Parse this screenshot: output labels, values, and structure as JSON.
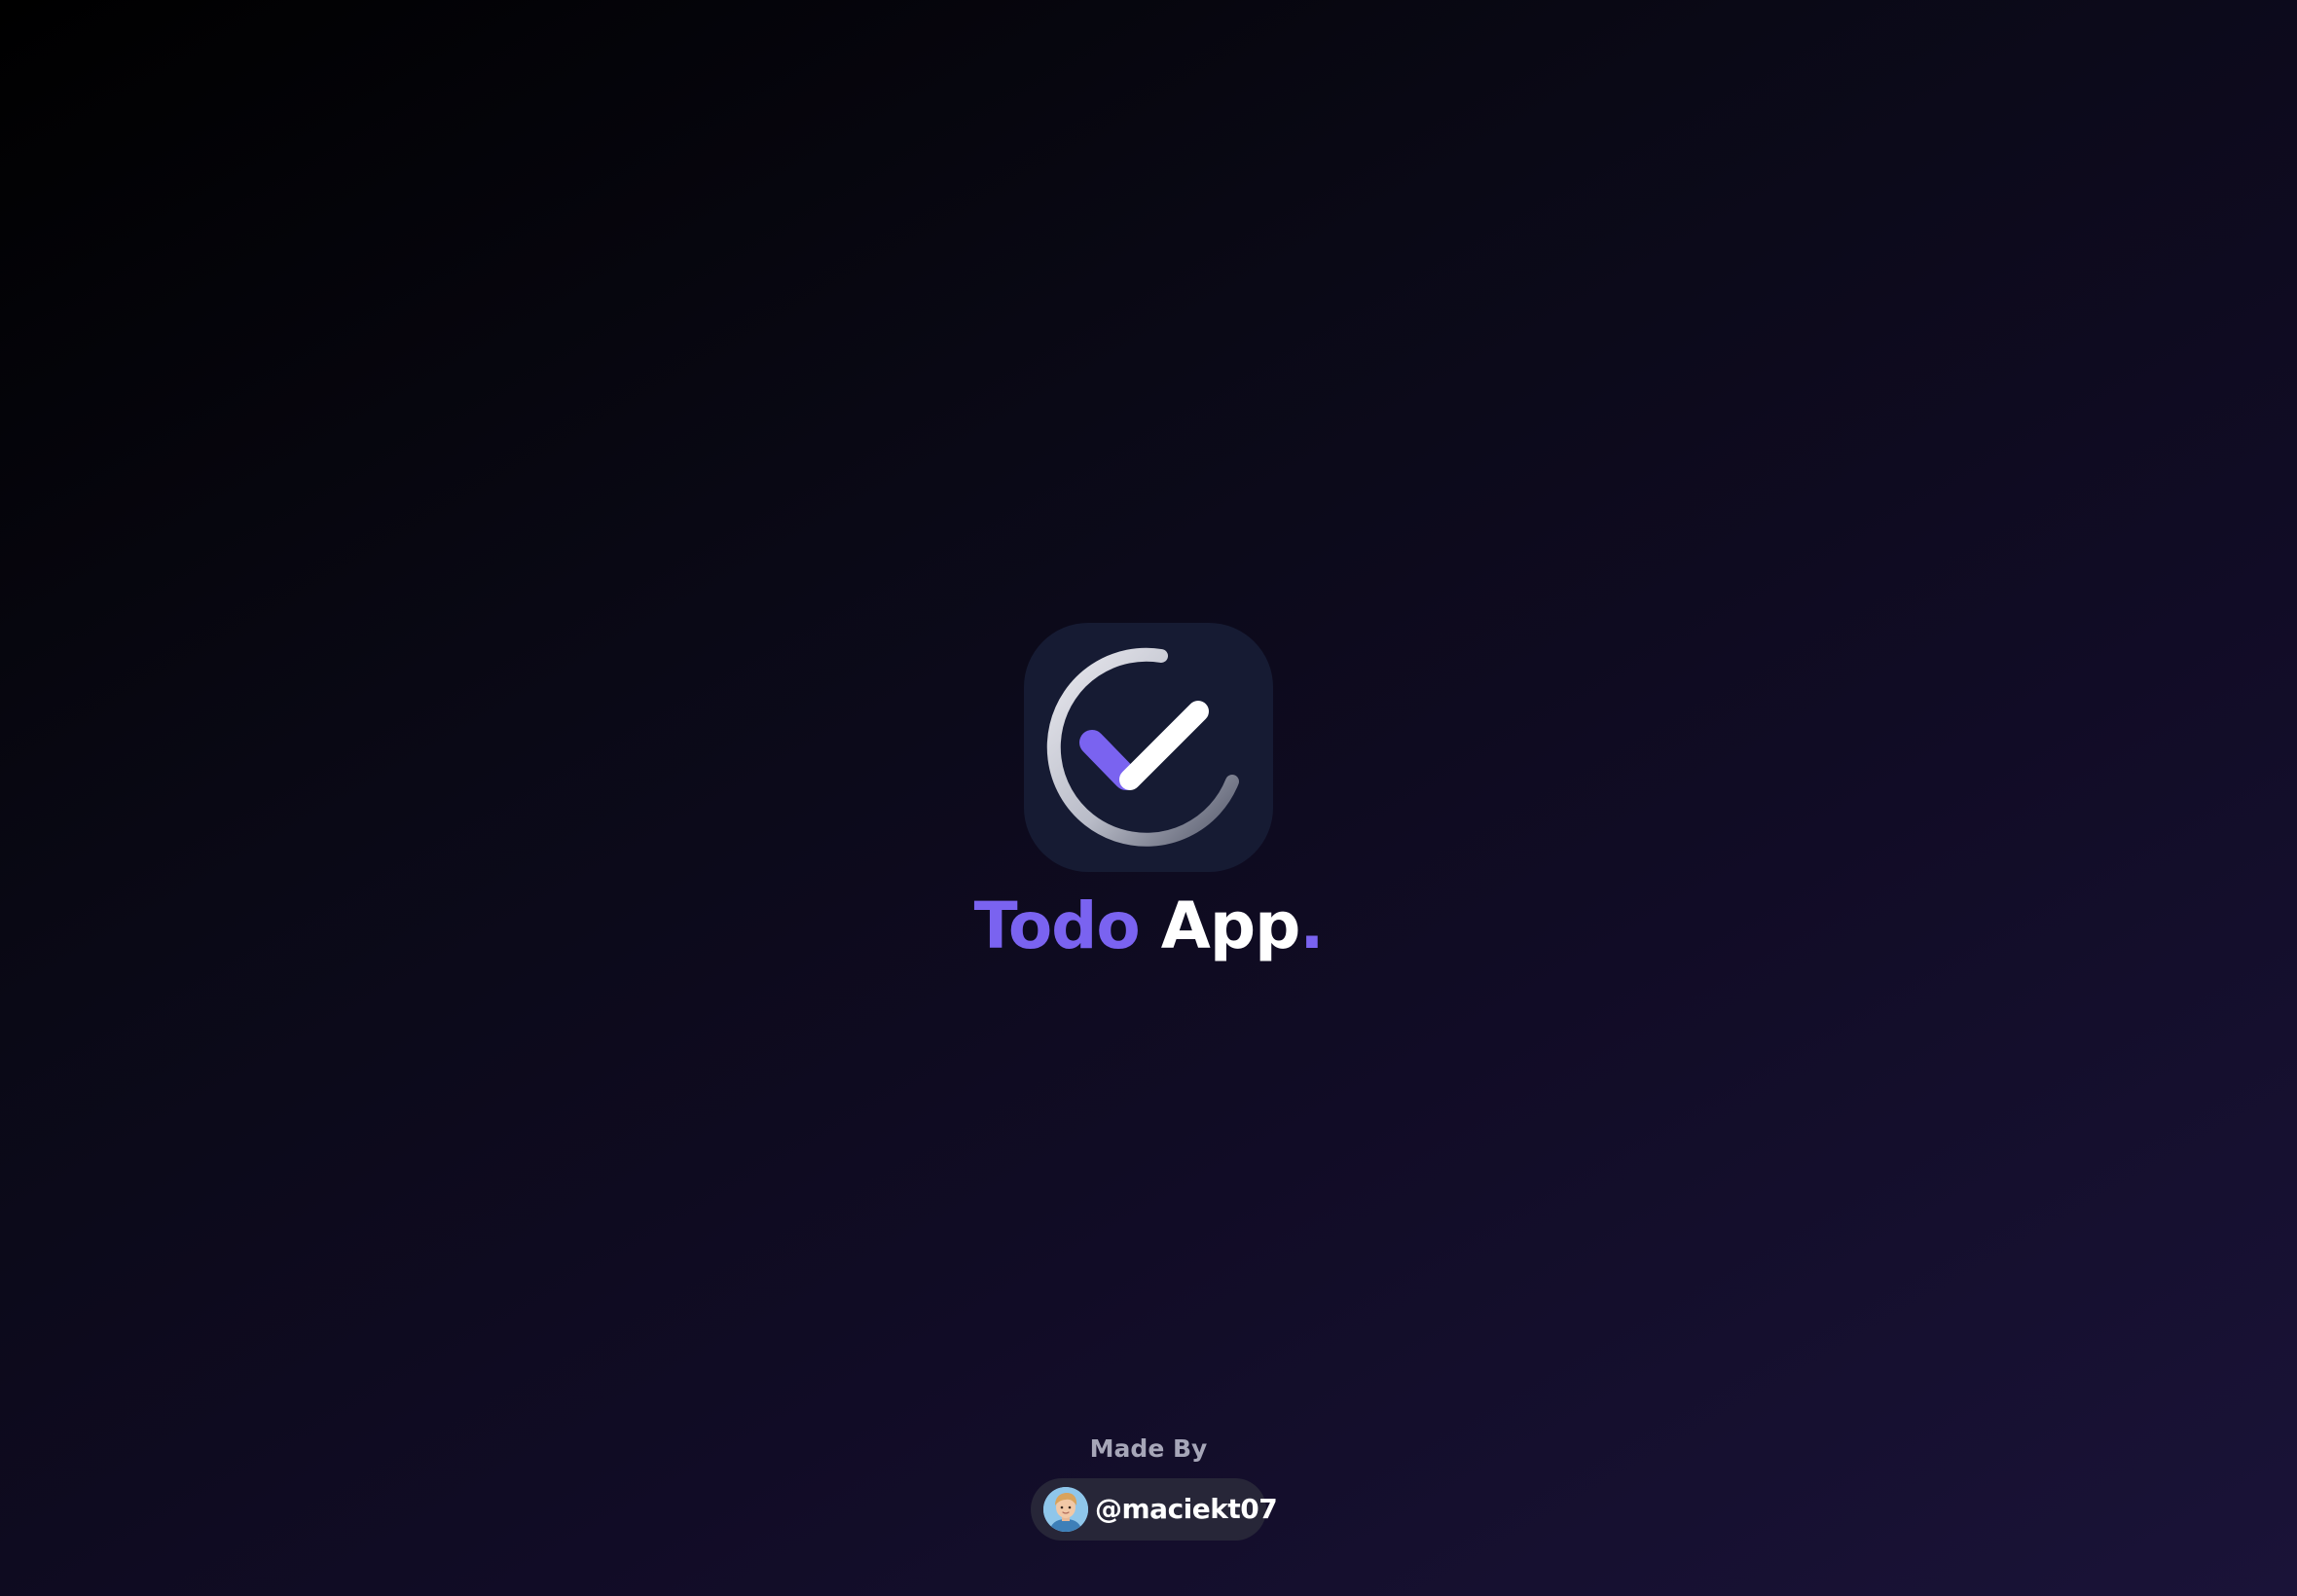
{
  "app": {
    "logo_icon": "check-circle-icon",
    "title_part1": "Todo",
    "title_part2": "App",
    "title_dot": "."
  },
  "footer": {
    "made_by_label": "Made By",
    "author_handle": "@maciekt07",
    "author_avatar_icon": "avatar-icon"
  },
  "colors": {
    "accent": "#7a63f0",
    "icon_background": "#161b33",
    "pill_background": "#272638",
    "title_white": "#ffffff",
    "muted_text": "#a6a6b8"
  }
}
